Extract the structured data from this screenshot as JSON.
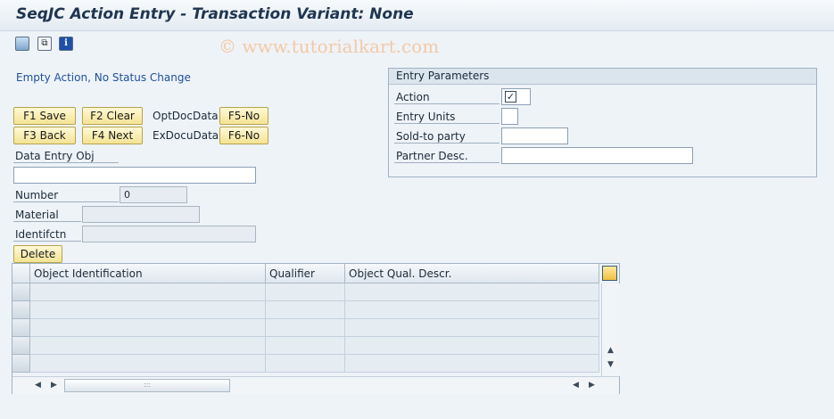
{
  "window": {
    "title": "SeqJC Action Entry - Transaction Variant: None"
  },
  "toolbar": {
    "icons": [
      "save-layout-icon",
      "copy-icon",
      "info-icon"
    ]
  },
  "watermark": "© www.tutorialkart.com",
  "status_message": "Empty Action, No Status Change",
  "buttons": {
    "f1": "F1 Save",
    "f2": "F2 Clear",
    "f3": "F3 Back",
    "f4": "F4 Next",
    "f5": "F5-No",
    "f6": "F6-No"
  },
  "labels": {
    "opt_doc_data": "OptDocData",
    "ex_docu_data": "ExDocuData",
    "data_entry_obj": "Data Entry Obj",
    "number": "Number",
    "material": "Material",
    "identification": "Identifctn"
  },
  "fields": {
    "data_entry_obj": "",
    "number": "0",
    "material": "",
    "identification": ""
  },
  "entry_parameters": {
    "title": "Entry Parameters",
    "action_label": "Action",
    "action_checked": true,
    "entry_units_label": "Entry Units",
    "sold_to_label": "Sold-to party",
    "partner_desc_label": "Partner Desc.",
    "entry_units": "",
    "sold_to": "",
    "partner_desc": ""
  },
  "delete_button": "Delete",
  "table": {
    "columns": [
      "Object Identification",
      "Qualifier",
      "Object Qual. Descr."
    ],
    "rows": [
      [
        "",
        "",
        ""
      ],
      [
        "",
        "",
        ""
      ],
      [
        "",
        "",
        ""
      ],
      [
        "",
        "",
        ""
      ],
      [
        "",
        "",
        ""
      ]
    ]
  },
  "scroll": {
    "handle_glyph": ":::"
  }
}
